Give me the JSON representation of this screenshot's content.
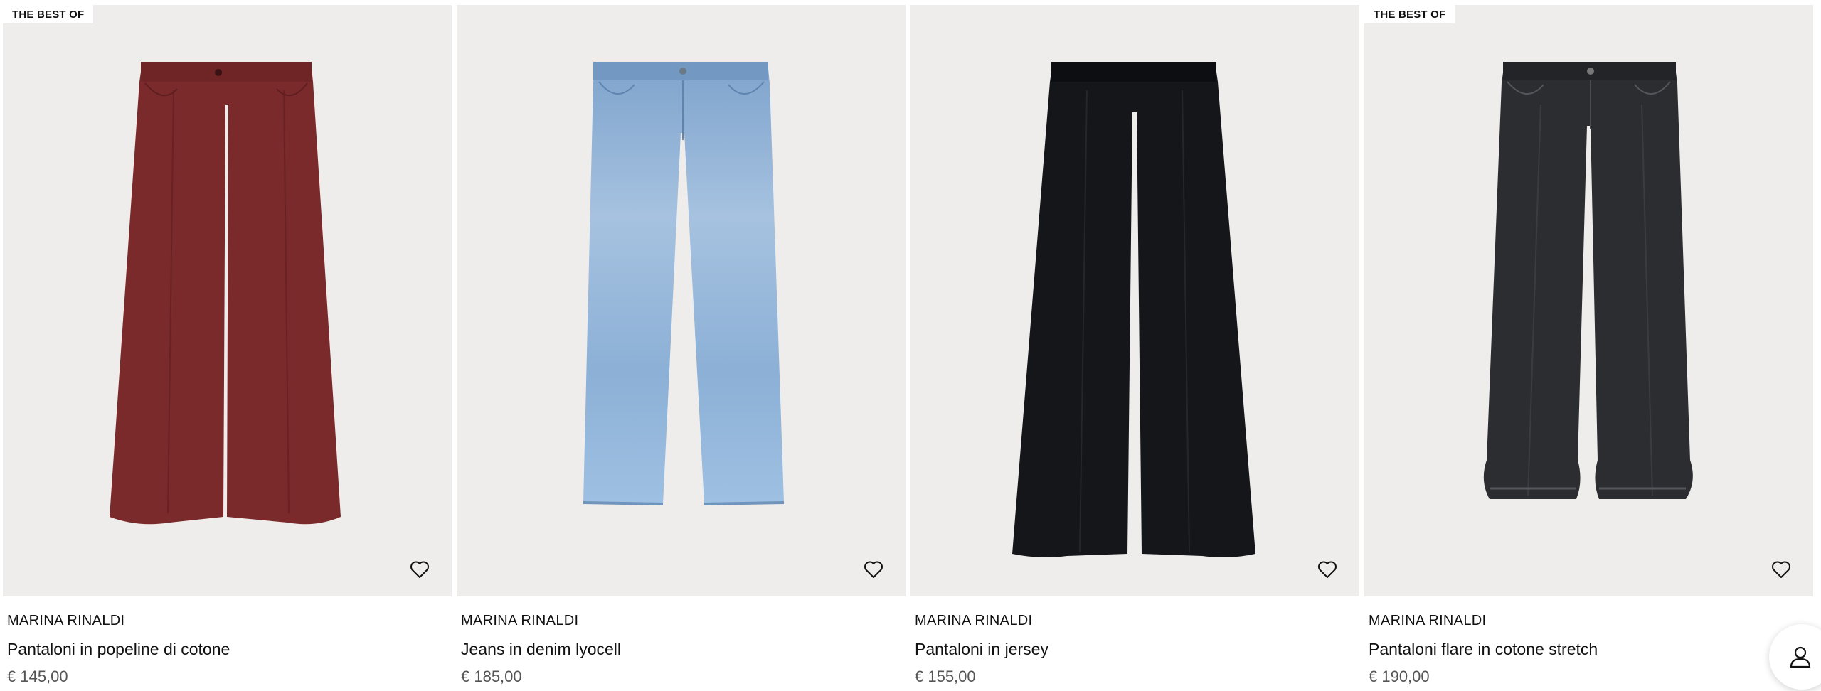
{
  "products": [
    {
      "badge": "THE BEST OF",
      "brand": "MARINA RINALDI",
      "name": "Pantaloni in popeline di cotone",
      "price": "€ 145,00",
      "color": "#7b2a2c"
    },
    {
      "badge": "",
      "brand": "MARINA RINALDI",
      "name": "Jeans in denim lyocell",
      "price": "€ 185,00",
      "color": "#8fb2d6"
    },
    {
      "badge": "",
      "brand": "MARINA RINALDI",
      "name": "Pantaloni in jersey",
      "price": "€ 155,00",
      "color": "#15161a"
    },
    {
      "badge": "THE BEST OF",
      "brand": "MARINA RINALDI",
      "name": "Pantaloni flare in cotone stretch",
      "price": "€ 190,00",
      "color": "#2c2d31"
    }
  ],
  "icons": {
    "wishlist": "heart-outline-icon",
    "account": "user-icon"
  }
}
